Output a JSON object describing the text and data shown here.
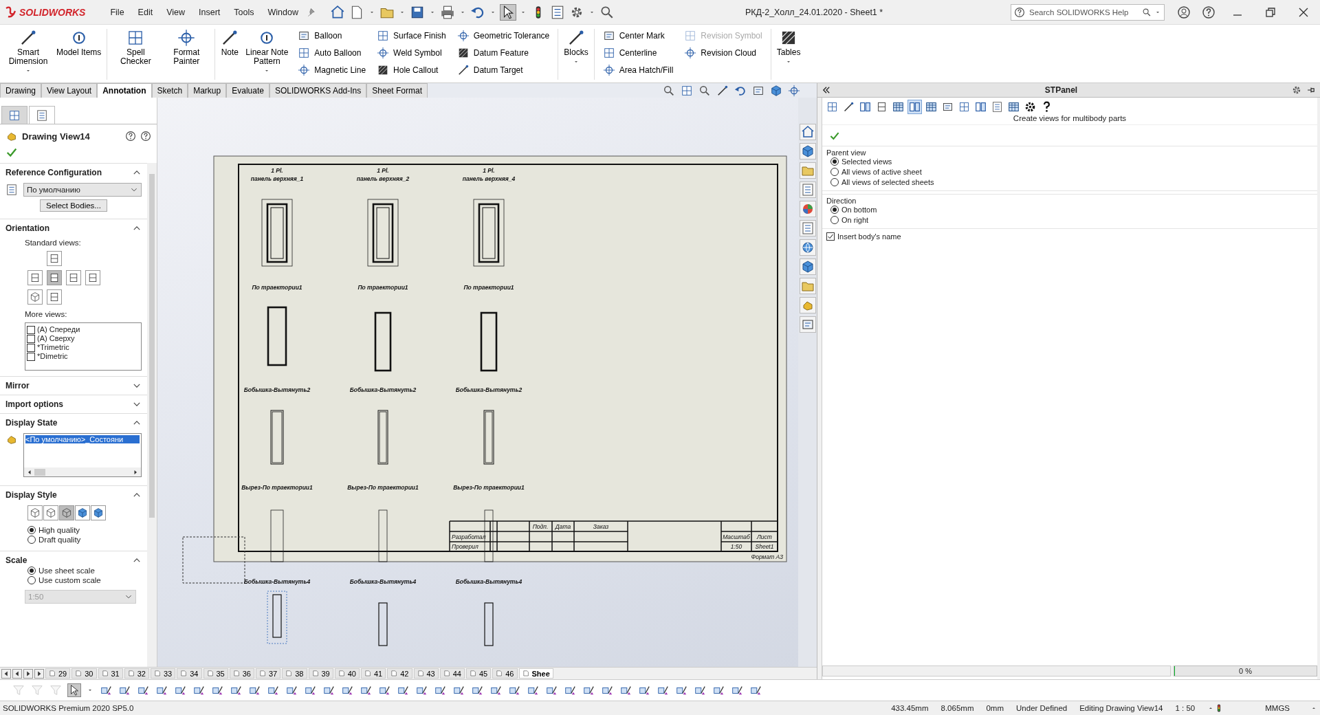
{
  "app": {
    "logo": "SOLIDWORKS",
    "menu": [
      "File",
      "Edit",
      "View",
      "Insert",
      "Tools",
      "Window"
    ],
    "title": "РКД-2_Холл_24.01.2020 - Sheet1 *",
    "search": {
      "placeholder": "Search SOLIDWORKS Help"
    }
  },
  "ribbon": [
    {
      "kind": "large",
      "label": "Smart Dimension",
      "dropdown": true
    },
    {
      "kind": "large",
      "label": "Model Items",
      "dropdown": false
    },
    {
      "kind": "separator"
    },
    {
      "kind": "large",
      "label": "Spell Checker",
      "dropdown": false
    },
    {
      "kind": "large",
      "label": "Format Painter",
      "dropdown": false
    },
    {
      "kind": "separator"
    },
    {
      "kind": "large",
      "label": "Note",
      "dropdown": false
    },
    {
      "kind": "large",
      "label": "Linear Note Pattern",
      "dropdown": true
    },
    {
      "kind": "stack",
      "items": [
        {
          "label": "Balloon",
          "disabled": false
        },
        {
          "label": "Auto Balloon",
          "disabled": false
        },
        {
          "label": "Magnetic Line",
          "disabled": false
        }
      ]
    },
    {
      "kind": "stack",
      "items": [
        {
          "label": "Surface Finish",
          "disabled": false
        },
        {
          "label": "Weld Symbol",
          "disabled": false
        },
        {
          "label": "Hole Callout",
          "disabled": false
        }
      ]
    },
    {
      "kind": "stack",
      "items": [
        {
          "label": "Geometric Tolerance",
          "disabled": false
        },
        {
          "label": "Datum Feature",
          "disabled": false
        },
        {
          "label": "Datum Target",
          "disabled": false
        }
      ]
    },
    {
      "kind": "separator"
    },
    {
      "kind": "large",
      "label": "Blocks",
      "dropdown": true
    },
    {
      "kind": "separator"
    },
    {
      "kind": "stack",
      "items": [
        {
          "label": "Center Mark",
          "disabled": false
        },
        {
          "label": "Centerline",
          "disabled": false
        },
        {
          "label": "Area Hatch/Fill",
          "disabled": false
        }
      ]
    },
    {
      "kind": "stack",
      "items": [
        {
          "label": "Revision Symbol",
          "disabled": true
        },
        {
          "label": "Revision Cloud",
          "disabled": false
        }
      ]
    },
    {
      "kind": "separator"
    },
    {
      "kind": "large",
      "label": "Tables",
      "dropdown": true
    }
  ],
  "command_tabs": [
    {
      "label": "Drawing",
      "selected": false
    },
    {
      "label": "View Layout",
      "selected": false
    },
    {
      "label": "Annotation",
      "selected": true
    },
    {
      "label": "Sketch",
      "selected": false
    },
    {
      "label": "Markup",
      "selected": false
    },
    {
      "label": "Evaluate",
      "selected": false
    },
    {
      "label": "SOLIDWORKS Add-Ins",
      "selected": false
    },
    {
      "label": "Sheet Format",
      "selected": false
    }
  ],
  "property_manager": {
    "tabs": [
      {
        "selected": false
      },
      {
        "selected": true
      }
    ],
    "title": "Drawing View14",
    "sections": [
      {
        "kind": "reference",
        "title": "Reference Configuration",
        "expanded": true,
        "config": "По умолчанию",
        "button": "Select Bodies..."
      },
      {
        "kind": "orientation",
        "title": "Orientation",
        "expanded": true,
        "standard_label": "Standard views:",
        "standard_views": [
          {
            "selected": false
          },
          {
            "selected": false
          },
          {
            "selected": true
          },
          {
            "selected": false
          },
          {
            "selected": false
          },
          {
            "selected": false
          },
          {
            "selected": false
          }
        ],
        "more_label": "More views:",
        "more_views": [
          {
            "label": "(A) Спереди",
            "checked": false
          },
          {
            "label": "(A) Сверху",
            "checked": false
          },
          {
            "label": "*Trimetric",
            "checked": false
          },
          {
            "label": "*Dimetric",
            "checked": false
          }
        ]
      },
      {
        "kind": "plain",
        "title": "Mirror",
        "expanded": false
      },
      {
        "kind": "plain",
        "title": "Import options",
        "expanded": false
      },
      {
        "kind": "display_state",
        "title": "Display State",
        "expanded": true,
        "states": [
          {
            "label": "<По умолчанию>_Состояни",
            "selected": true
          }
        ]
      },
      {
        "kind": "display_style",
        "title": "Display Style",
        "expanded": true,
        "styles": [
          {
            "selected": false
          },
          {
            "selected": false
          },
          {
            "selected": true
          },
          {
            "selected": false
          },
          {
            "selected": false
          }
        ],
        "quality": [
          {
            "label": "High quality",
            "selected": true
          },
          {
            "label": "Draft quality",
            "selected": false
          }
        ]
      },
      {
        "kind": "scale",
        "title": "Scale",
        "expanded": true,
        "options": [
          {
            "label": "Use sheet scale",
            "selected": true
          },
          {
            "label": "Use custom scale",
            "selected": false
          }
        ],
        "custom_value": "1:50",
        "custom_disabled": true
      }
    ]
  },
  "drawing": {
    "view_rows": [
      {
        "kind": "panel",
        "cells": [
          {
            "count": "1 Pl.",
            "label": "панель верхняя_1",
            "selected": false
          },
          {
            "count": "1 Pl.",
            "label": "панель верхняя_2",
            "selected": false
          },
          {
            "count": "1 Pl.",
            "label": "панель верхняя_4",
            "selected": false
          }
        ]
      },
      {
        "kind": "solid",
        "cells": [
          {
            "label": "По траектории1",
            "selected": false
          },
          {
            "label": "По траектории1",
            "selected": false
          },
          {
            "label": "По траектории1",
            "selected": false
          }
        ]
      },
      {
        "kind": "double",
        "cells": [
          {
            "label": "Бобышка-Вытянуть2",
            "selected": false
          },
          {
            "label": "Бобышка-Вытянуть2",
            "selected": false
          },
          {
            "label": "Бобышка-Вытянуть2",
            "selected": false
          }
        ]
      },
      {
        "kind": "cut",
        "cells": [
          {
            "label": "Вырез-По траектории1",
            "selected": false
          },
          {
            "label": "Вырез-По траектории1",
            "selected": false
          },
          {
            "label": "Вырез-По траектории1",
            "selected": false
          }
        ]
      },
      {
        "kind": "thin",
        "cells": [
          {
            "label": "Бобышка-Вытянуть4",
            "selected": true
          },
          {
            "label": "Бобышка-Вытянуть4",
            "selected": false
          },
          {
            "label": "Бобышка-Вытянуть4",
            "selected": false
          }
        ]
      }
    ],
    "title_block": {
      "headers": [
        "Подп.",
        "Дата",
        "Заказ"
      ],
      "rows": [
        "Разработал",
        "Проверил"
      ],
      "scale_label": "Масштаб",
      "sheet_label": "Лист",
      "scale": "1:50",
      "sheet": "Sheet1",
      "format": "Формат А3"
    }
  },
  "sheet_tabs": [
    {
      "label": "29",
      "selected": false
    },
    {
      "label": "30",
      "selected": false
    },
    {
      "label": "31",
      "selected": false
    },
    {
      "label": "32",
      "selected": false
    },
    {
      "label": "33",
      "selected": false
    },
    {
      "label": "34",
      "selected": false
    },
    {
      "label": "35",
      "selected": false
    },
    {
      "label": "36",
      "selected": false
    },
    {
      "label": "37",
      "selected": false
    },
    {
      "label": "38",
      "selected": false
    },
    {
      "label": "39",
      "selected": false
    },
    {
      "label": "40",
      "selected": false
    },
    {
      "label": "41",
      "selected": false
    },
    {
      "label": "42",
      "selected": false
    },
    {
      "label": "43",
      "selected": false
    },
    {
      "label": "44",
      "selected": false
    },
    {
      "label": "45",
      "selected": false
    },
    {
      "label": "46",
      "selected": false
    },
    {
      "label": "Shee",
      "selected": true
    }
  ],
  "stpanel": {
    "title": "STPanel",
    "tools": [
      {
        "selected": false
      },
      {
        "selected": false
      },
      {
        "selected": false
      },
      {
        "selected": false
      },
      {
        "selected": false
      },
      {
        "selected": true
      },
      {
        "selected": false
      },
      {
        "selected": false
      },
      {
        "selected": false
      },
      {
        "selected": false
      },
      {
        "selected": false
      },
      {
        "selected": false
      },
      {
        "selected": false
      },
      {
        "selected": false
      }
    ],
    "hint": "Create views for multibody parts",
    "groups": [
      {
        "title": "Parent view",
        "options": [
          {
            "label": "Selected views",
            "selected": true
          },
          {
            "label": "All views of active sheet",
            "selected": false
          },
          {
            "label": "All views of selected sheets",
            "selected": false
          }
        ]
      },
      {
        "title": "Direction",
        "options": [
          {
            "label": "On bottom",
            "selected": true
          },
          {
            "label": "On right",
            "selected": false
          }
        ]
      }
    ],
    "insert_name": {
      "label": "Insert body's name",
      "checked": true
    },
    "progress": {
      "level": 0,
      "reading": "0 %"
    }
  },
  "status_bar": {
    "product": "SOLIDWORKS Premium 2020 SP5.0",
    "fields": [
      "433.45mm",
      "8.065mm",
      "0mm",
      "Under Defined",
      "Editing Drawing View14",
      "1 : 50"
    ],
    "units": "MMGS"
  }
}
